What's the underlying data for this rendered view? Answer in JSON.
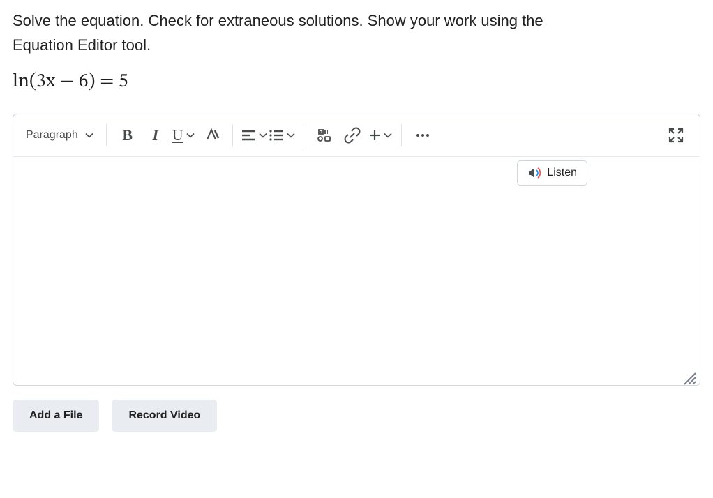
{
  "question": {
    "text_line1": "Solve the equation.  Check for extraneous solutions.  Show your work using the",
    "text_line2": "Equation Editor tool.",
    "equation": "ln(3x − 6) = 5"
  },
  "toolbar": {
    "paragraph_label": "Paragraph",
    "bold": "B",
    "italic": "I",
    "underline": "U"
  },
  "listen": {
    "label": "Listen"
  },
  "actions": {
    "add_file": "Add a File",
    "record_video": "Record Video"
  }
}
